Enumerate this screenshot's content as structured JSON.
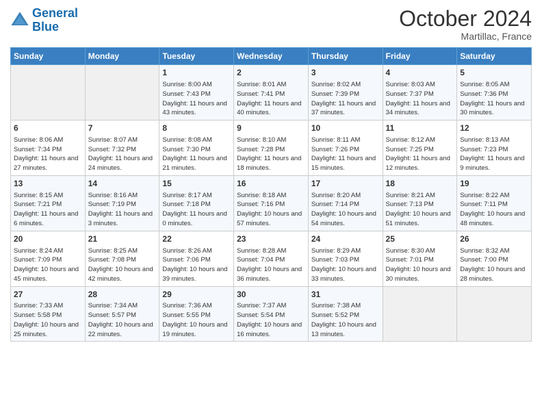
{
  "logo": {
    "line1": "General",
    "line2": "Blue"
  },
  "title": "October 2024",
  "subtitle": "Martillac, France",
  "days_header": [
    "Sunday",
    "Monday",
    "Tuesday",
    "Wednesday",
    "Thursday",
    "Friday",
    "Saturday"
  ],
  "weeks": [
    [
      {
        "num": "",
        "info": ""
      },
      {
        "num": "",
        "info": ""
      },
      {
        "num": "1",
        "info": "Sunrise: 8:00 AM\nSunset: 7:43 PM\nDaylight: 11 hours and 43 minutes."
      },
      {
        "num": "2",
        "info": "Sunrise: 8:01 AM\nSunset: 7:41 PM\nDaylight: 11 hours and 40 minutes."
      },
      {
        "num": "3",
        "info": "Sunrise: 8:02 AM\nSunset: 7:39 PM\nDaylight: 11 hours and 37 minutes."
      },
      {
        "num": "4",
        "info": "Sunrise: 8:03 AM\nSunset: 7:37 PM\nDaylight: 11 hours and 34 minutes."
      },
      {
        "num": "5",
        "info": "Sunrise: 8:05 AM\nSunset: 7:36 PM\nDaylight: 11 hours and 30 minutes."
      }
    ],
    [
      {
        "num": "6",
        "info": "Sunrise: 8:06 AM\nSunset: 7:34 PM\nDaylight: 11 hours and 27 minutes."
      },
      {
        "num": "7",
        "info": "Sunrise: 8:07 AM\nSunset: 7:32 PM\nDaylight: 11 hours and 24 minutes."
      },
      {
        "num": "8",
        "info": "Sunrise: 8:08 AM\nSunset: 7:30 PM\nDaylight: 11 hours and 21 minutes."
      },
      {
        "num": "9",
        "info": "Sunrise: 8:10 AM\nSunset: 7:28 PM\nDaylight: 11 hours and 18 minutes."
      },
      {
        "num": "10",
        "info": "Sunrise: 8:11 AM\nSunset: 7:26 PM\nDaylight: 11 hours and 15 minutes."
      },
      {
        "num": "11",
        "info": "Sunrise: 8:12 AM\nSunset: 7:25 PM\nDaylight: 11 hours and 12 minutes."
      },
      {
        "num": "12",
        "info": "Sunrise: 8:13 AM\nSunset: 7:23 PM\nDaylight: 11 hours and 9 minutes."
      }
    ],
    [
      {
        "num": "13",
        "info": "Sunrise: 8:15 AM\nSunset: 7:21 PM\nDaylight: 11 hours and 6 minutes."
      },
      {
        "num": "14",
        "info": "Sunrise: 8:16 AM\nSunset: 7:19 PM\nDaylight: 11 hours and 3 minutes."
      },
      {
        "num": "15",
        "info": "Sunrise: 8:17 AM\nSunset: 7:18 PM\nDaylight: 11 hours and 0 minutes."
      },
      {
        "num": "16",
        "info": "Sunrise: 8:18 AM\nSunset: 7:16 PM\nDaylight: 10 hours and 57 minutes."
      },
      {
        "num": "17",
        "info": "Sunrise: 8:20 AM\nSunset: 7:14 PM\nDaylight: 10 hours and 54 minutes."
      },
      {
        "num": "18",
        "info": "Sunrise: 8:21 AM\nSunset: 7:13 PM\nDaylight: 10 hours and 51 minutes."
      },
      {
        "num": "19",
        "info": "Sunrise: 8:22 AM\nSunset: 7:11 PM\nDaylight: 10 hours and 48 minutes."
      }
    ],
    [
      {
        "num": "20",
        "info": "Sunrise: 8:24 AM\nSunset: 7:09 PM\nDaylight: 10 hours and 45 minutes."
      },
      {
        "num": "21",
        "info": "Sunrise: 8:25 AM\nSunset: 7:08 PM\nDaylight: 10 hours and 42 minutes."
      },
      {
        "num": "22",
        "info": "Sunrise: 8:26 AM\nSunset: 7:06 PM\nDaylight: 10 hours and 39 minutes."
      },
      {
        "num": "23",
        "info": "Sunrise: 8:28 AM\nSunset: 7:04 PM\nDaylight: 10 hours and 36 minutes."
      },
      {
        "num": "24",
        "info": "Sunrise: 8:29 AM\nSunset: 7:03 PM\nDaylight: 10 hours and 33 minutes."
      },
      {
        "num": "25",
        "info": "Sunrise: 8:30 AM\nSunset: 7:01 PM\nDaylight: 10 hours and 30 minutes."
      },
      {
        "num": "26",
        "info": "Sunrise: 8:32 AM\nSunset: 7:00 PM\nDaylight: 10 hours and 28 minutes."
      }
    ],
    [
      {
        "num": "27",
        "info": "Sunrise: 7:33 AM\nSunset: 5:58 PM\nDaylight: 10 hours and 25 minutes."
      },
      {
        "num": "28",
        "info": "Sunrise: 7:34 AM\nSunset: 5:57 PM\nDaylight: 10 hours and 22 minutes."
      },
      {
        "num": "29",
        "info": "Sunrise: 7:36 AM\nSunset: 5:55 PM\nDaylight: 10 hours and 19 minutes."
      },
      {
        "num": "30",
        "info": "Sunrise: 7:37 AM\nSunset: 5:54 PM\nDaylight: 10 hours and 16 minutes."
      },
      {
        "num": "31",
        "info": "Sunrise: 7:38 AM\nSunset: 5:52 PM\nDaylight: 10 hours and 13 minutes."
      },
      {
        "num": "",
        "info": ""
      },
      {
        "num": "",
        "info": ""
      }
    ]
  ]
}
